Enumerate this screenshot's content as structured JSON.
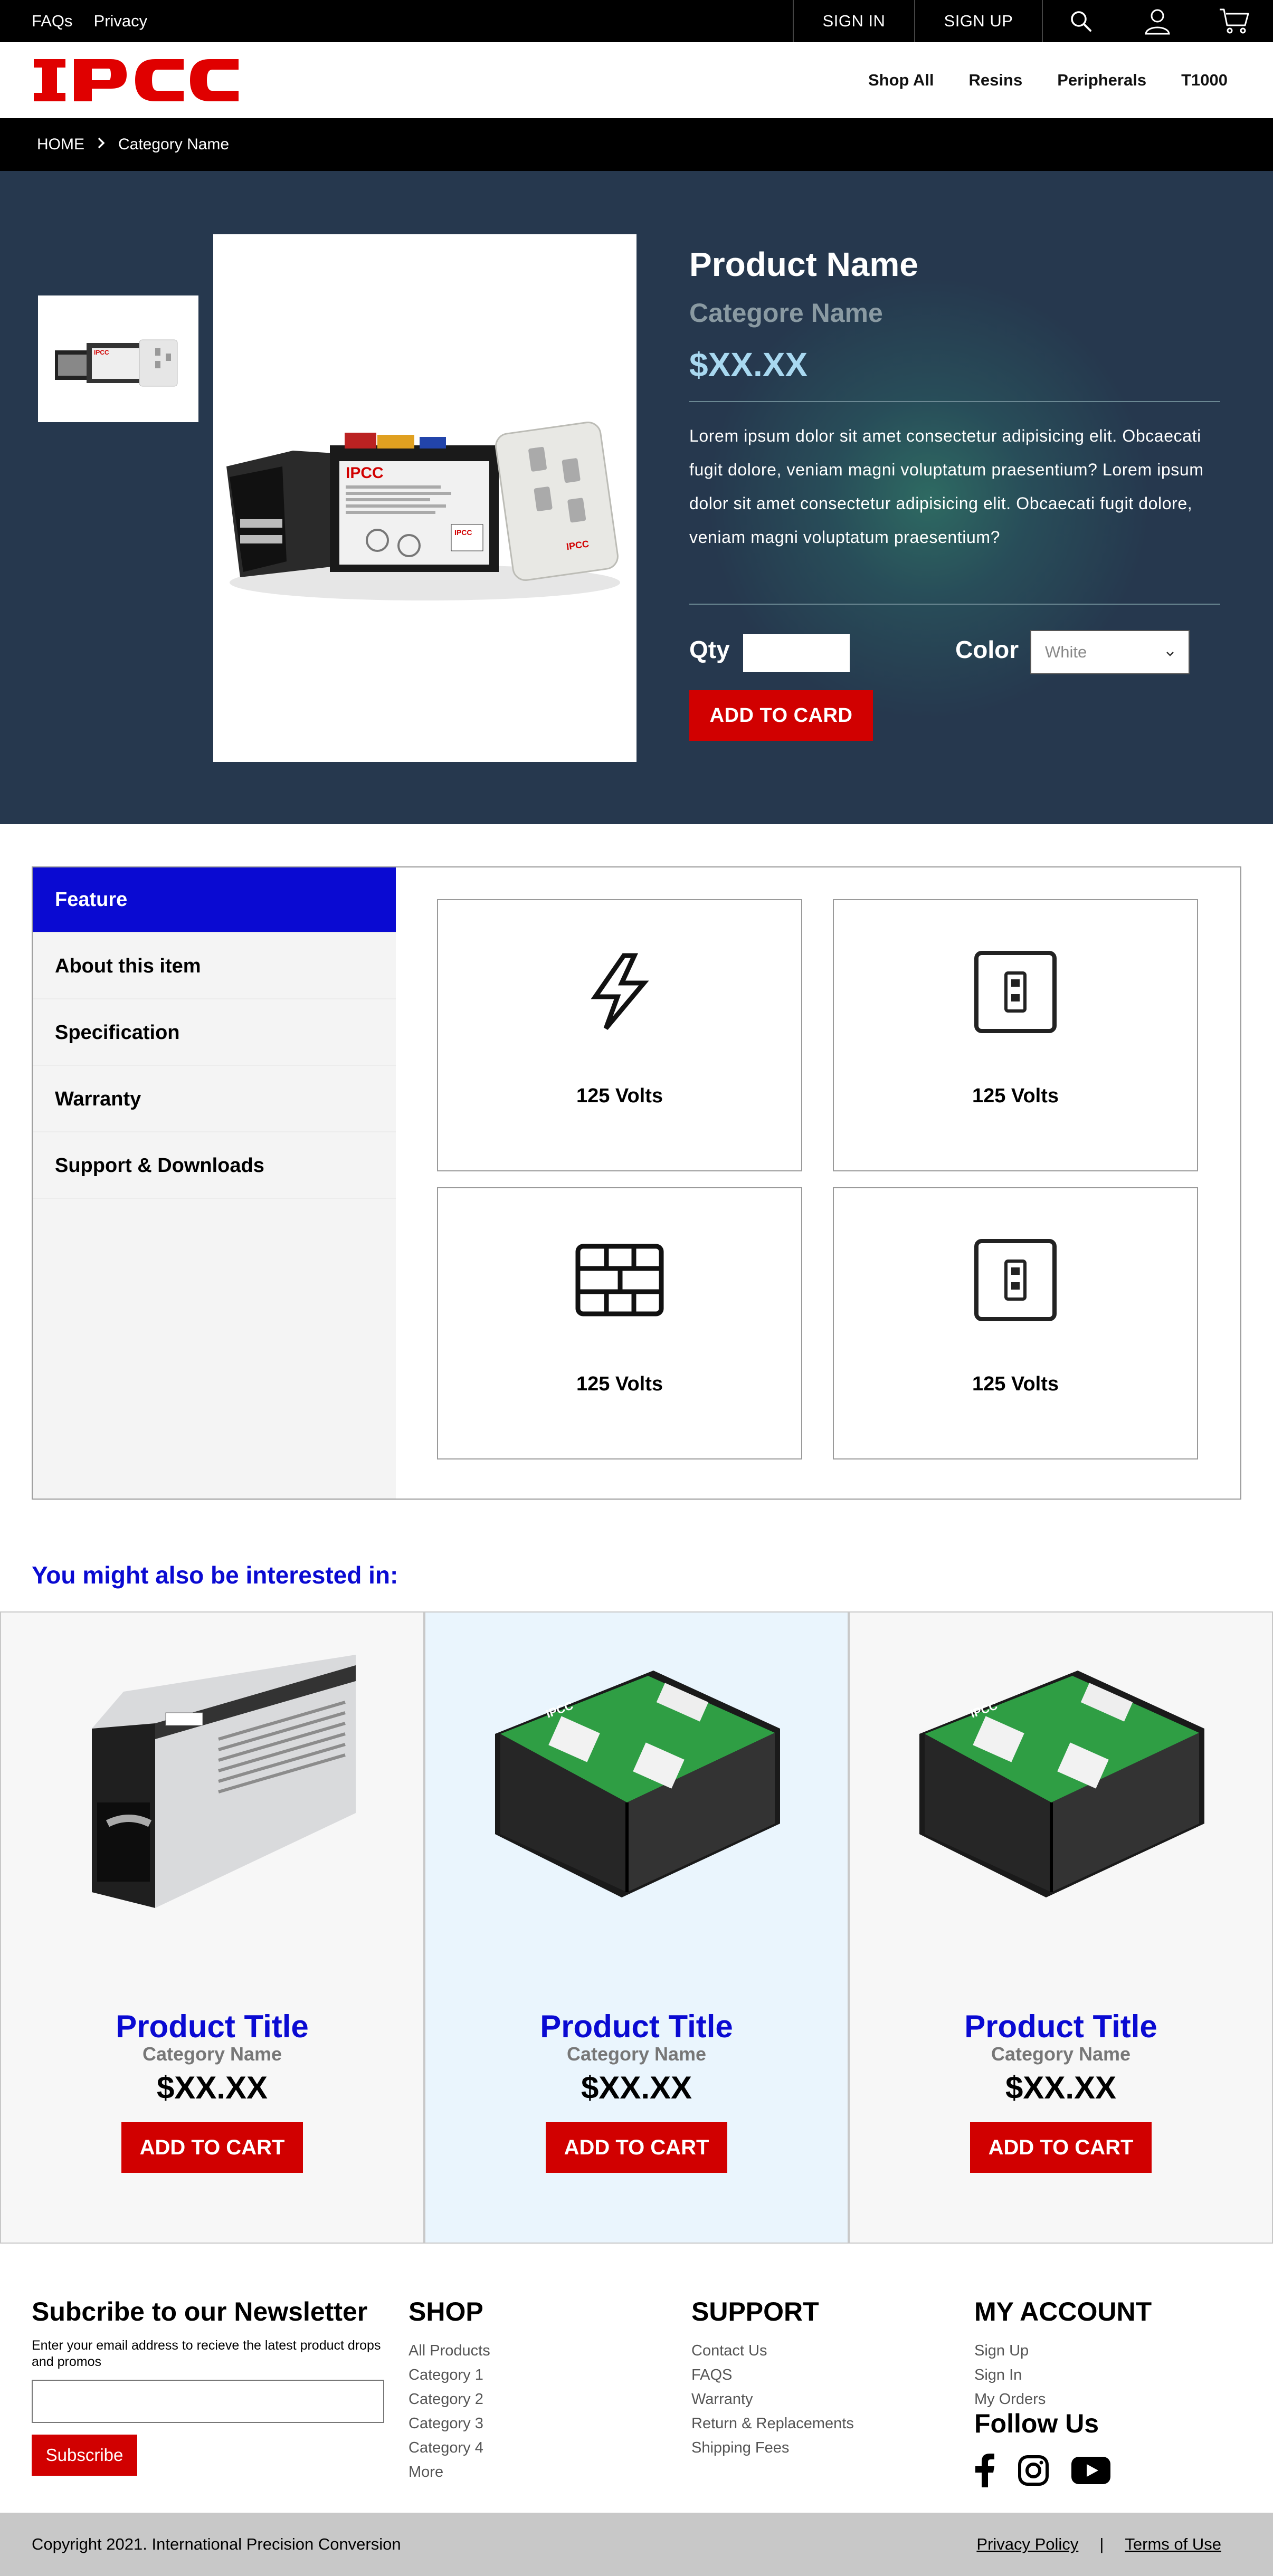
{
  "topbar": {
    "links": [
      "FAQs",
      "Privacy"
    ],
    "sign_in": "SIGN IN",
    "sign_up": "SIGN UP",
    "icons": [
      "search-icon",
      "user-icon",
      "cart-icon"
    ]
  },
  "header": {
    "logo_text": "IPCC",
    "nav": [
      "Shop All",
      "Resins",
      "Peripherals",
      "T1000"
    ]
  },
  "breadcrumb": {
    "home": "HOME",
    "current": "Category Name"
  },
  "product": {
    "name": "Product Name",
    "category": "Categore Name",
    "price": "$XX.XX",
    "description": "Lorem ipsum dolor sit amet consectetur adipisicing elit. Obcaecati fugit dolore, veniam magni voluptatum praesentium? Lorem ipsum dolor sit amet consectetur adipisicing elit. Obcaecati fugit dolore, veniam magni voluptatum praesentium?",
    "qty_label": "Qty",
    "qty_value": "",
    "color_label": "Color",
    "color_value": "White",
    "add_button": "ADD TO CARD",
    "image_label": "IPCC"
  },
  "features": {
    "tabs": [
      "Feature",
      "About this item",
      "Specification",
      "Warranty",
      "Support & Downloads"
    ],
    "active_tab": "Feature",
    "cards": [
      {
        "icon": "lightning-icon",
        "label": "125 Volts"
      },
      {
        "icon": "outlet-icon",
        "label": "125 Volts"
      },
      {
        "icon": "firewall-icon",
        "label": "125 Volts"
      },
      {
        "icon": "outlet-icon",
        "label": "125 Volts"
      }
    ]
  },
  "related": {
    "title": "You might also be interested in:",
    "items": [
      {
        "title": "Product Title",
        "category": "Category Name",
        "price": "$XX.XX",
        "button": "ADD TO CART"
      },
      {
        "title": "Product Title",
        "category": "Category Name",
        "price": "$XX.XX",
        "button": "ADD TO CART"
      },
      {
        "title": "Product Title",
        "category": "Category Name",
        "price": "$XX.XX",
        "button": "ADD TO CART"
      }
    ]
  },
  "footer": {
    "newsletter_title": "Subcribe to our Newsletter",
    "newsletter_desc": "Enter your email address to recieve the latest product drops and promos",
    "newsletter_input": "",
    "subscribe_button": "Subscribe",
    "shop_title": "SHOP",
    "shop_links": [
      "All Products",
      "Category 1",
      "Category 2",
      "Category 3",
      "Category 4",
      "More"
    ],
    "support_title": "SUPPORT",
    "support_links": [
      "Contact Us",
      "FAQS",
      "Warranty",
      "Return & Replacements",
      "Shipping Fees"
    ],
    "account_title": "MY ACCOUNT",
    "account_links": [
      "Sign Up",
      "Sign In",
      "My Orders"
    ],
    "follow_title": "Follow Us",
    "social": [
      "facebook-icon",
      "instagram-icon",
      "youtube-icon"
    ],
    "copyright": "Copyright 2021. International Precision Conversion",
    "privacy": "Privacy Policy",
    "separator": "|",
    "terms": "Terms of Use"
  },
  "colors": {
    "accent_red": "#d10000",
    "accent_blue": "#0a0ad2",
    "hero_bg": "#26384e",
    "price_blue": "#a8d8f0"
  }
}
